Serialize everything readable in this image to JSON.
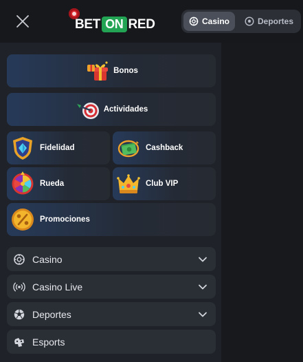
{
  "header": {
    "logo": {
      "text_bet": "BET",
      "text_on": "ON",
      "text_red": "RED"
    },
    "segment": [
      {
        "label": "Casino",
        "active": true
      },
      {
        "label": "Deportes",
        "active": false
      }
    ]
  },
  "tiles": [
    {
      "label": "Bonos",
      "icon": "gift-icon"
    },
    {
      "label": "Actividades",
      "icon": "dart-target-icon"
    },
    {
      "label": "Fidelidad",
      "icon": "shield-gem-icon"
    },
    {
      "label": "Cashback",
      "icon": "cash-icon"
    },
    {
      "label": "Rueda",
      "icon": "wheel-icon"
    },
    {
      "label": "Club VIP",
      "icon": "crown-icon"
    },
    {
      "label": "Promociones",
      "icon": "percent-coin-icon"
    }
  ],
  "accordion": [
    {
      "label": "Casino",
      "icon": "casino-chip-icon",
      "has_chevron": true
    },
    {
      "label": "Casino Live",
      "icon": "live-broadcast-icon",
      "has_chevron": true
    },
    {
      "label": "Deportes",
      "icon": "soccer-ball-icon",
      "has_chevron": true
    },
    {
      "label": "Esports",
      "icon": "gamepad-icon",
      "has_chevron": false
    }
  ],
  "colors": {
    "brand_green": "#23a455",
    "brand_red": "#d8232a",
    "tile_blue": "#263a59",
    "panel": "#1f2228"
  }
}
